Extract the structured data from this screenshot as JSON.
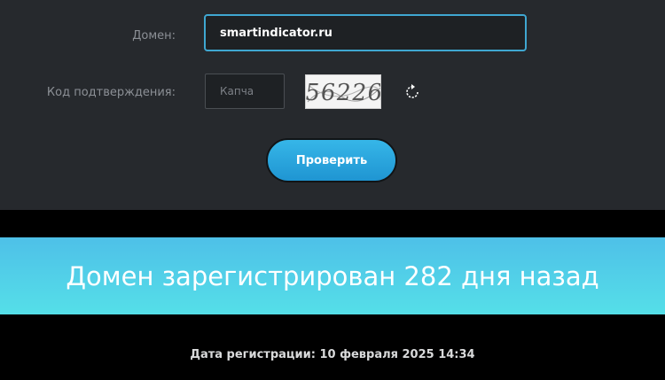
{
  "form": {
    "domain_label": "Домен:",
    "domain_value": "smartindicator.ru",
    "code_label": "Код подтверждения:",
    "captcha_placeholder": "Капча",
    "captcha_text": "56226",
    "refresh_icon": "refresh-icon",
    "submit_label": "Проверить"
  },
  "result": {
    "headline": "Домен зарегистрирован 282 дня назад",
    "registration_date": "Дата регистрации: 10 февраля 2025 14:34"
  },
  "colors": {
    "panel_bg": "#26292d",
    "accent": "#3fa7d1",
    "button": "#2aa6e0",
    "banner_start": "#4ec0e8",
    "banner_end": "#55dfe8"
  }
}
